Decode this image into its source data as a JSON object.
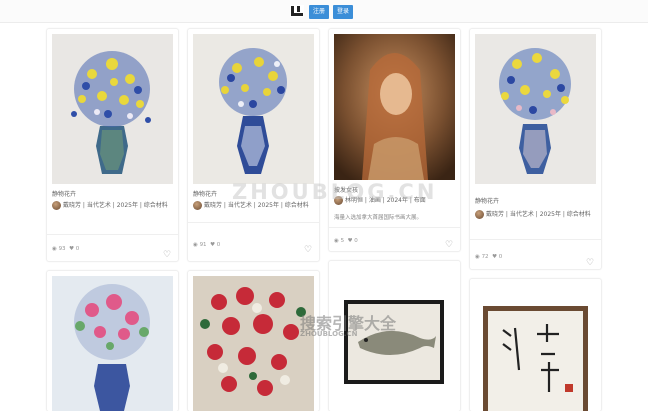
{
  "header": {
    "register_label": "注册",
    "login_label": "登录"
  },
  "watermark": {
    "brand_cn": "搜索引擎大全",
    "domain": "ZHOUBLOG.CN"
  },
  "cards": [
    {
      "title": "静物花卉",
      "artist": "戴晓芳",
      "meta": "当代艺术 | 2025年 | 综合材料",
      "views": "93",
      "likes": "0"
    },
    {
      "title": "静物花卉",
      "artist": "戴晓芳",
      "meta": "当代艺术 | 2025年 | 综合材料",
      "views": "91",
      "likes": "0"
    },
    {
      "title": "披发女孩",
      "artist": "林明恒",
      "meta": "油画 | 2024年 | 布面",
      "desc": "海量入选加拿大首届国际书画大展。",
      "views": "5",
      "likes": "0"
    },
    {
      "title": "静物花卉",
      "artist": "戴晓芳",
      "meta": "当代艺术 | 2025年 | 综合材料",
      "views": "72",
      "likes": "0"
    }
  ],
  "icons": {
    "eye": "eye-icon",
    "like": "thumb-icon",
    "favorite": "heart-icon"
  }
}
